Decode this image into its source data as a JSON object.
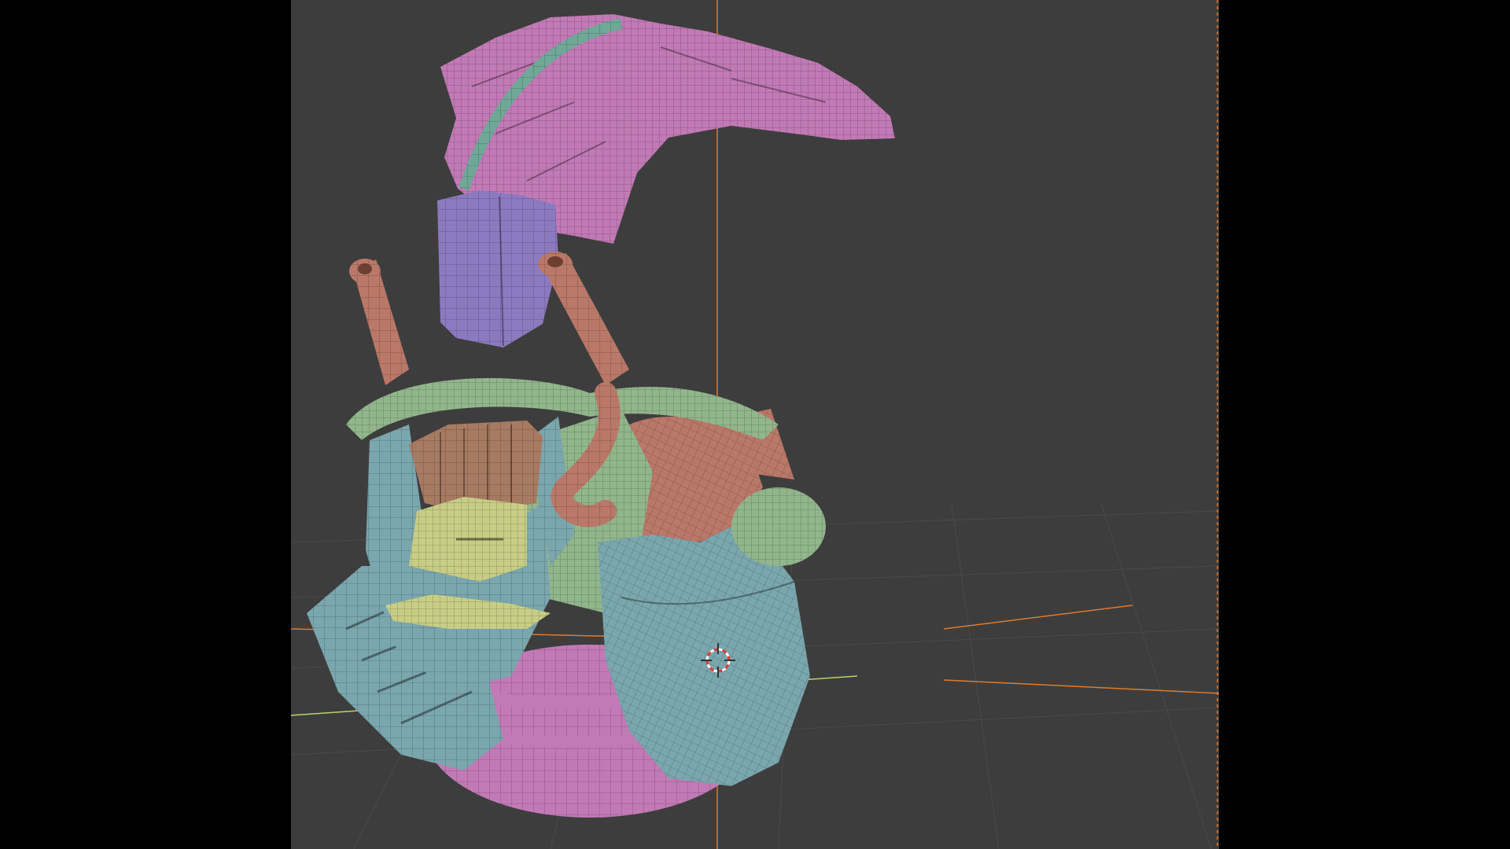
{
  "viewport": {
    "type": "3d-viewport",
    "shading": "solid-wireframe",
    "background": "#3d3d3d",
    "letterbox": "#000000"
  },
  "axes": {
    "x_color": "#e07a2c",
    "y_color": "#b9d36b",
    "z_color": "#e07a2c"
  },
  "gizmo": {
    "icon": "3d-cursor-icon",
    "colors": [
      "#e23a3a",
      "#ffffff"
    ]
  },
  "model": {
    "parts": [
      {
        "name": "crest-plate",
        "color": "#c27ab6"
      },
      {
        "name": "cable",
        "color": "#6fa897"
      },
      {
        "name": "top-box",
        "color": "#8c7ac0"
      },
      {
        "name": "vent-pipe-left",
        "color": "#b97868"
      },
      {
        "name": "vent-pipe-right",
        "color": "#b97868"
      },
      {
        "name": "face-plate",
        "color": "#7aa6ad"
      },
      {
        "name": "strap",
        "color": "#92b68c"
      },
      {
        "name": "visor-box",
        "color": "#a77a62"
      },
      {
        "name": "hook",
        "color": "#b97868"
      },
      {
        "name": "mouth-guard",
        "color": "#c8cd86"
      },
      {
        "name": "cheek-guard",
        "color": "#7aa6ad"
      },
      {
        "name": "jaw-sphere",
        "color": "#c27ab6"
      },
      {
        "name": "shoulder-pad",
        "color": "#b97868"
      }
    ]
  }
}
